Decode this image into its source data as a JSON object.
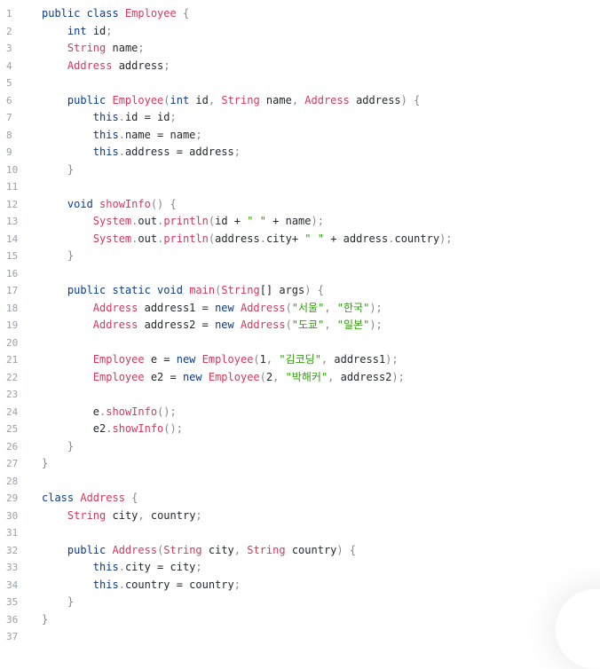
{
  "editor": {
    "lines": [
      {
        "n": "1",
        "tokens": [
          {
            "t": "public class ",
            "c": "kw"
          },
          {
            "t": "Employee",
            "c": "ty"
          },
          {
            "t": " {",
            "c": "pu"
          }
        ]
      },
      {
        "n": "2",
        "tokens": [
          {
            "t": "    "
          },
          {
            "t": "int",
            "c": "kw"
          },
          {
            "t": " id"
          },
          {
            "t": ";",
            "c": "pu"
          }
        ]
      },
      {
        "n": "3",
        "tokens": [
          {
            "t": "    "
          },
          {
            "t": "String",
            "c": "ty"
          },
          {
            "t": " name"
          },
          {
            "t": ";",
            "c": "pu"
          }
        ]
      },
      {
        "n": "4",
        "tokens": [
          {
            "t": "    "
          },
          {
            "t": "Address",
            "c": "ty"
          },
          {
            "t": " address"
          },
          {
            "t": ";",
            "c": "pu"
          }
        ]
      },
      {
        "n": "5",
        "tokens": []
      },
      {
        "n": "6",
        "tokens": [
          {
            "t": "    "
          },
          {
            "t": "public ",
            "c": "kw"
          },
          {
            "t": "Employee",
            "c": "fn"
          },
          {
            "t": "(",
            "c": "pu"
          },
          {
            "t": "int",
            "c": "kw"
          },
          {
            "t": " id"
          },
          {
            "t": ", ",
            "c": "pu"
          },
          {
            "t": "String",
            "c": "ty"
          },
          {
            "t": " name"
          },
          {
            "t": ", ",
            "c": "pu"
          },
          {
            "t": "Address",
            "c": "ty"
          },
          {
            "t": " address"
          },
          {
            "t": ") {",
            "c": "pu"
          }
        ]
      },
      {
        "n": "7",
        "tokens": [
          {
            "t": "        "
          },
          {
            "t": "this",
            "c": "kw"
          },
          {
            "t": ".",
            "c": "pu"
          },
          {
            "t": "id = id"
          },
          {
            "t": ";",
            "c": "pu"
          }
        ]
      },
      {
        "n": "8",
        "tokens": [
          {
            "t": "        "
          },
          {
            "t": "this",
            "c": "kw"
          },
          {
            "t": ".",
            "c": "pu"
          },
          {
            "t": "name = name"
          },
          {
            "t": ";",
            "c": "pu"
          }
        ]
      },
      {
        "n": "9",
        "tokens": [
          {
            "t": "        "
          },
          {
            "t": "this",
            "c": "kw"
          },
          {
            "t": ".",
            "c": "pu"
          },
          {
            "t": "address = address"
          },
          {
            "t": ";",
            "c": "pu"
          }
        ]
      },
      {
        "n": "10",
        "tokens": [
          {
            "t": "    "
          },
          {
            "t": "}",
            "c": "pu"
          }
        ]
      },
      {
        "n": "11",
        "tokens": []
      },
      {
        "n": "12",
        "tokens": [
          {
            "t": "    "
          },
          {
            "t": "void ",
            "c": "kw"
          },
          {
            "t": "showInfo",
            "c": "fn"
          },
          {
            "t": "() {",
            "c": "pu"
          }
        ]
      },
      {
        "n": "13",
        "tokens": [
          {
            "t": "        "
          },
          {
            "t": "System",
            "c": "ty"
          },
          {
            "t": ".",
            "c": "pu"
          },
          {
            "t": "out",
            "c": "nu"
          },
          {
            "t": ".",
            "c": "pu"
          },
          {
            "t": "println",
            "c": "fn"
          },
          {
            "t": "(",
            "c": "pu"
          },
          {
            "t": "id + "
          },
          {
            "t": "\" \"",
            "c": "st"
          },
          {
            "t": " + name"
          },
          {
            "t": ");",
            "c": "pu"
          }
        ]
      },
      {
        "n": "14",
        "tokens": [
          {
            "t": "        "
          },
          {
            "t": "System",
            "c": "ty"
          },
          {
            "t": ".",
            "c": "pu"
          },
          {
            "t": "out",
            "c": "nu"
          },
          {
            "t": ".",
            "c": "pu"
          },
          {
            "t": "println",
            "c": "fn"
          },
          {
            "t": "(",
            "c": "pu"
          },
          {
            "t": "address"
          },
          {
            "t": ".",
            "c": "pu"
          },
          {
            "t": "city+ "
          },
          {
            "t": "\" \"",
            "c": "st"
          },
          {
            "t": " + address"
          },
          {
            "t": ".",
            "c": "pu"
          },
          {
            "t": "country"
          },
          {
            "t": ");",
            "c": "pu"
          }
        ]
      },
      {
        "n": "15",
        "tokens": [
          {
            "t": "    "
          },
          {
            "t": "}",
            "c": "pu"
          }
        ]
      },
      {
        "n": "16",
        "tokens": []
      },
      {
        "n": "17",
        "tokens": [
          {
            "t": "    "
          },
          {
            "t": "public static void ",
            "c": "kw"
          },
          {
            "t": "main",
            "c": "fn"
          },
          {
            "t": "(",
            "c": "pu"
          },
          {
            "t": "String",
            "c": "ty"
          },
          {
            "t": "[] args"
          },
          {
            "t": ") {",
            "c": "pu"
          }
        ]
      },
      {
        "n": "18",
        "tokens": [
          {
            "t": "        "
          },
          {
            "t": "Address",
            "c": "ty"
          },
          {
            "t": " address1 = "
          },
          {
            "t": "new ",
            "c": "kw"
          },
          {
            "t": "Address",
            "c": "ty"
          },
          {
            "t": "(",
            "c": "pu"
          },
          {
            "t": "\"서울\"",
            "c": "st"
          },
          {
            "t": ", ",
            "c": "pu"
          },
          {
            "t": "\"한국\"",
            "c": "st"
          },
          {
            "t": ");",
            "c": "pu"
          }
        ]
      },
      {
        "n": "19",
        "tokens": [
          {
            "t": "        "
          },
          {
            "t": "Address",
            "c": "ty"
          },
          {
            "t": " address2 = "
          },
          {
            "t": "new ",
            "c": "kw"
          },
          {
            "t": "Address",
            "c": "ty"
          },
          {
            "t": "(",
            "c": "pu"
          },
          {
            "t": "\"도쿄\"",
            "c": "st"
          },
          {
            "t": ", ",
            "c": "pu"
          },
          {
            "t": "\"일본\"",
            "c": "st"
          },
          {
            "t": ");",
            "c": "pu"
          }
        ]
      },
      {
        "n": "20",
        "tokens": []
      },
      {
        "n": "21",
        "tokens": [
          {
            "t": "        "
          },
          {
            "t": "Employee",
            "c": "ty"
          },
          {
            "t": " e = "
          },
          {
            "t": "new ",
            "c": "kw"
          },
          {
            "t": "Employee",
            "c": "ty"
          },
          {
            "t": "(",
            "c": "pu"
          },
          {
            "t": "1"
          },
          {
            "t": ", ",
            "c": "pu"
          },
          {
            "t": "\"김코딩\"",
            "c": "st"
          },
          {
            "t": ", ",
            "c": "pu"
          },
          {
            "t": "address1"
          },
          {
            "t": ");",
            "c": "pu"
          }
        ]
      },
      {
        "n": "22",
        "tokens": [
          {
            "t": "        "
          },
          {
            "t": "Employee",
            "c": "ty"
          },
          {
            "t": " e2 = "
          },
          {
            "t": "new ",
            "c": "kw"
          },
          {
            "t": "Employee",
            "c": "ty"
          },
          {
            "t": "(",
            "c": "pu"
          },
          {
            "t": "2"
          },
          {
            "t": ", ",
            "c": "pu"
          },
          {
            "t": "\"박해커\"",
            "c": "st"
          },
          {
            "t": ", ",
            "c": "pu"
          },
          {
            "t": "address2"
          },
          {
            "t": ");",
            "c": "pu"
          }
        ]
      },
      {
        "n": "23",
        "tokens": []
      },
      {
        "n": "24",
        "tokens": [
          {
            "t": "        "
          },
          {
            "t": "e"
          },
          {
            "t": ".",
            "c": "pu"
          },
          {
            "t": "showInfo",
            "c": "fn"
          },
          {
            "t": "();",
            "c": "pu"
          }
        ]
      },
      {
        "n": "25",
        "tokens": [
          {
            "t": "        "
          },
          {
            "t": "e2"
          },
          {
            "t": ".",
            "c": "pu"
          },
          {
            "t": "showInfo",
            "c": "fn"
          },
          {
            "t": "();",
            "c": "pu"
          }
        ]
      },
      {
        "n": "26",
        "tokens": [
          {
            "t": "    "
          },
          {
            "t": "}",
            "c": "pu"
          }
        ]
      },
      {
        "n": "27",
        "tokens": [
          {
            "t": "}",
            "c": "pu"
          }
        ]
      },
      {
        "n": "28",
        "tokens": []
      },
      {
        "n": "29",
        "tokens": [
          {
            "t": "class ",
            "c": "kw"
          },
          {
            "t": "Address",
            "c": "ty"
          },
          {
            "t": " {",
            "c": "pu"
          }
        ]
      },
      {
        "n": "30",
        "tokens": [
          {
            "t": "    "
          },
          {
            "t": "String",
            "c": "ty"
          },
          {
            "t": " city"
          },
          {
            "t": ", ",
            "c": "pu"
          },
          {
            "t": "country"
          },
          {
            "t": ";",
            "c": "pu"
          }
        ]
      },
      {
        "n": "31",
        "tokens": []
      },
      {
        "n": "32",
        "tokens": [
          {
            "t": "    "
          },
          {
            "t": "public ",
            "c": "kw"
          },
          {
            "t": "Address",
            "c": "fn"
          },
          {
            "t": "(",
            "c": "pu"
          },
          {
            "t": "String",
            "c": "ty"
          },
          {
            "t": " city"
          },
          {
            "t": ", ",
            "c": "pu"
          },
          {
            "t": "String",
            "c": "ty"
          },
          {
            "t": " country"
          },
          {
            "t": ") {",
            "c": "pu"
          }
        ]
      },
      {
        "n": "33",
        "tokens": [
          {
            "t": "        "
          },
          {
            "t": "this",
            "c": "kw"
          },
          {
            "t": ".",
            "c": "pu"
          },
          {
            "t": "city = city"
          },
          {
            "t": ";",
            "c": "pu"
          }
        ]
      },
      {
        "n": "34",
        "tokens": [
          {
            "t": "        "
          },
          {
            "t": "this",
            "c": "kw"
          },
          {
            "t": ".",
            "c": "pu"
          },
          {
            "t": "country = country"
          },
          {
            "t": ";",
            "c": "pu"
          }
        ]
      },
      {
        "n": "35",
        "tokens": [
          {
            "t": "    "
          },
          {
            "t": "}",
            "c": "pu"
          }
        ]
      },
      {
        "n": "36",
        "tokens": [
          {
            "t": "}",
            "c": "pu"
          }
        ]
      },
      {
        "n": "37",
        "tokens": []
      }
    ]
  },
  "colors": {
    "keyword": "#0b3b8c",
    "type": "#d7375a",
    "string": "#2f9c0a",
    "punctuation": "#888888",
    "line_number": "#9aa0a6",
    "background": "#ffffff"
  }
}
